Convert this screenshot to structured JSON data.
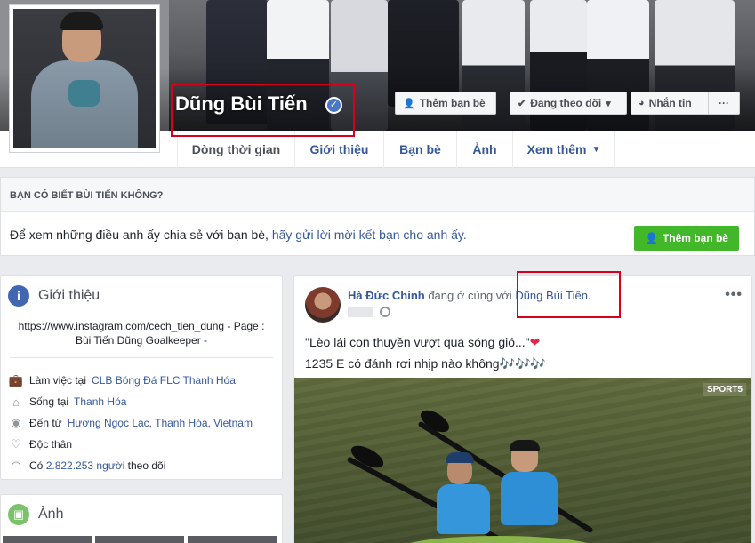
{
  "profile": {
    "name": "Dũng Bùi Tiến",
    "verified_icon": "check-icon"
  },
  "actions": {
    "add_friend": "Thêm bạn bè",
    "following": "Đang theo dõi",
    "message": "Nhắn tin",
    "more": "···"
  },
  "tabs": [
    {
      "label": "Dòng thời gian"
    },
    {
      "label": "Giới thiệu"
    },
    {
      "label": "Bạn bè"
    },
    {
      "label": "Ảnh"
    },
    {
      "label": "Xem thêm"
    }
  ],
  "know": {
    "heading": "BẠN CÓ BIẾT BÙI TIẾN KHÔNG?",
    "text": "Để xem những điều anh ấy chia sẻ với bạn bè, ",
    "link": "hãy gửi lời mời kết bạn cho anh ấy.",
    "button": "Thêm bạn bè"
  },
  "intro": {
    "title": "Giới thiệu",
    "bio_line1": "https://www.instagram.com/cech_tien_dung - Page :",
    "bio_line2": "Bùi Tiến Dũng Goalkeeper -",
    "rows": [
      {
        "prefix": "Làm việc tại ",
        "link": "CLB Bóng Đá FLC Thanh Hóa",
        "icon": "briefcase-icon"
      },
      {
        "prefix": "Sống tại ",
        "link": "Thanh Hóa",
        "icon": "home-icon"
      },
      {
        "prefix": "Đến từ ",
        "link": "Hương Ngọc Lac, Thanh Hóa, Vietnam",
        "icon": "pin-icon"
      },
      {
        "prefix": "Độc thân",
        "link": "",
        "icon": "heart-icon"
      },
      {
        "prefix": "Có ",
        "link": "2.822.253 người",
        "suffix": " theo dõi",
        "icon": "rss-icon"
      }
    ]
  },
  "photos": {
    "title": "Ảnh"
  },
  "post": {
    "author": "Hà Đức Chinh",
    "middle": " đang ở cùng với ",
    "tagged": "Dũng Bùi Tiến.",
    "line1": "\"Lèo lái con thuyền vượt qua sóng gió...\"",
    "line2": "1235 E có đánh rơi nhịp nào không🎶🎶🎶",
    "watermark": "SPORT5",
    "more": "•••"
  },
  "colors": {
    "link": "#365899",
    "green_button": "#42b72a",
    "highlight_box": "#d9001b"
  }
}
